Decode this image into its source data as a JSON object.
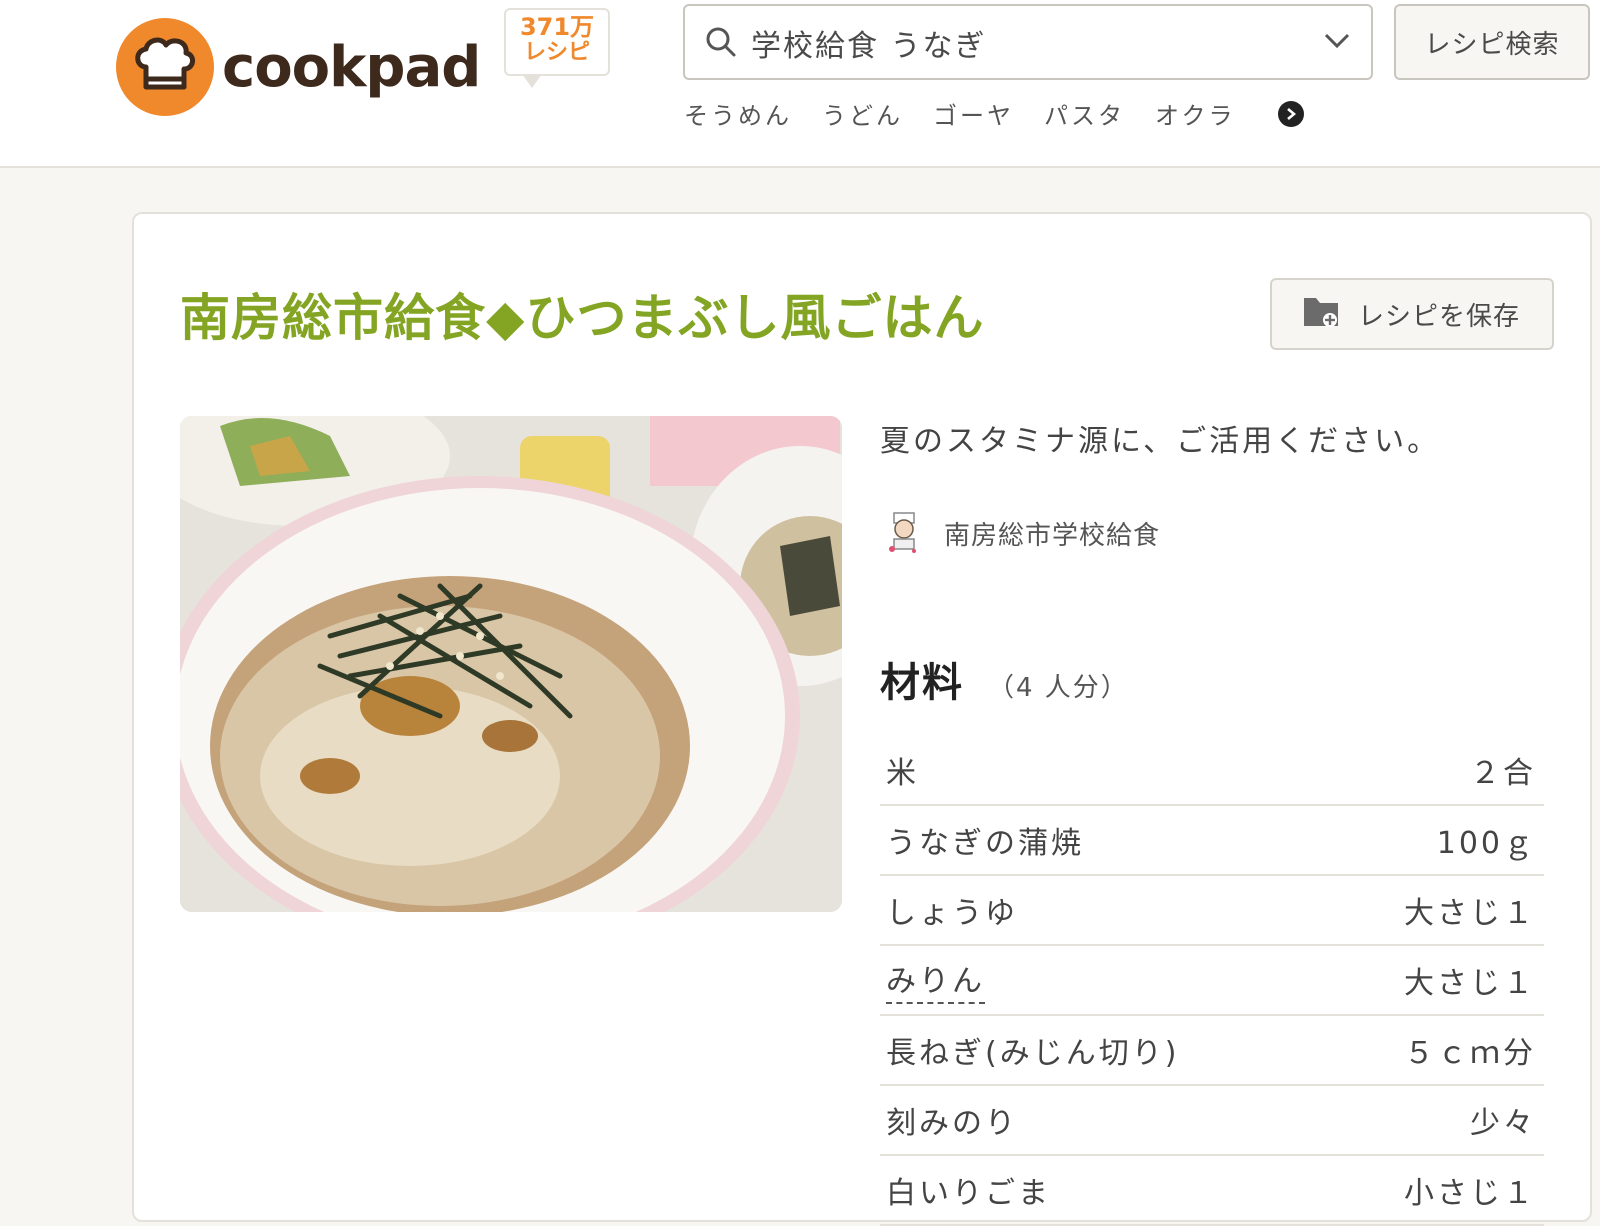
{
  "header": {
    "logo_text": "cookpad",
    "recipe_count": "371万",
    "recipe_count_unit": "レシピ",
    "search": {
      "value": "学校給食 うなぎ",
      "button_label": "レシピ検索"
    },
    "popular_keywords": [
      "そうめん",
      "うどん",
      "ゴーヤ",
      "パスタ",
      "オクラ"
    ]
  },
  "recipe": {
    "title": "南房総市給食◆ひつまぶし風ごはん",
    "save_label": "レシピを保存",
    "description": "夏のスタミナ源に、ご活用ください。",
    "author": "南房総市学校給食",
    "ingredients_heading": "材料",
    "servings": "（4 人分）",
    "ingredients": [
      {
        "name": "米",
        "quantity": "２合"
      },
      {
        "name": "うなぎの蒲焼",
        "quantity": "100ｇ"
      },
      {
        "name": "しょうゆ",
        "quantity": "大さじ１"
      },
      {
        "name": "みりん",
        "quantity": "大さじ１"
      },
      {
        "name": "長ねぎ(みじん切り)",
        "quantity": "５ｃｍ分"
      },
      {
        "name": "刻みのり",
        "quantity": "少々"
      },
      {
        "name": "白いりごま",
        "quantity": "小さじ１"
      }
    ]
  },
  "colors": {
    "brand_orange": "#f0882c",
    "title_green": "#84a524",
    "background": "#f8f6f2"
  }
}
